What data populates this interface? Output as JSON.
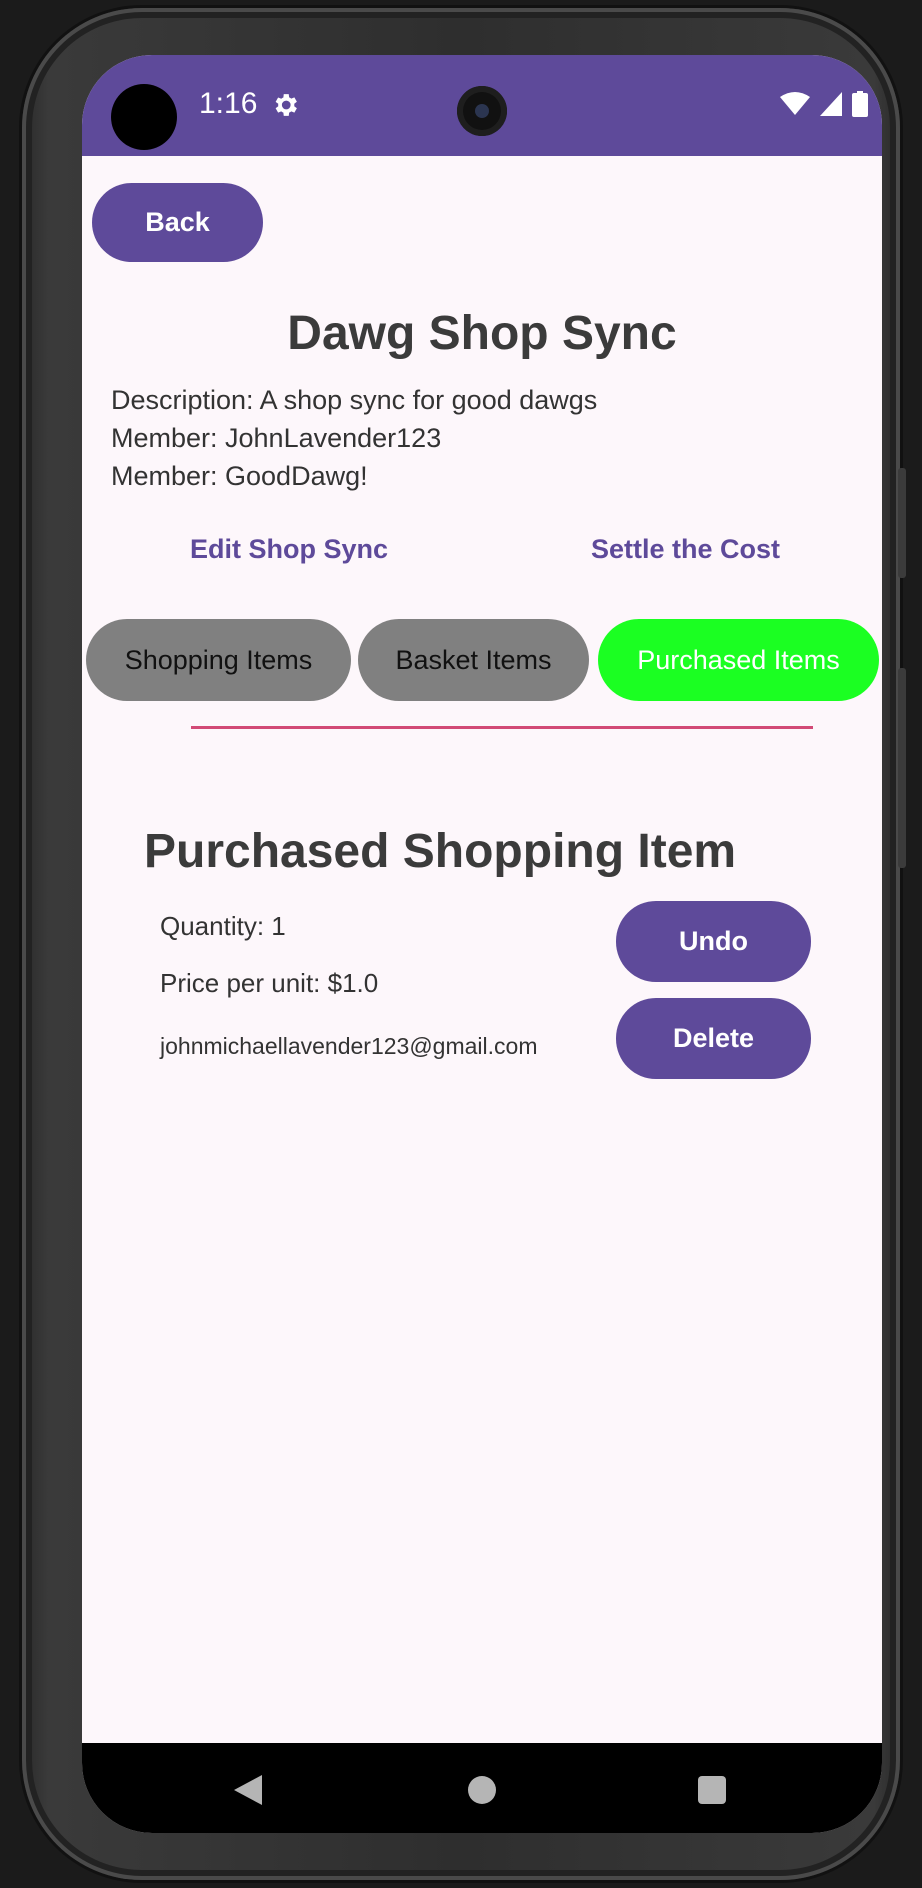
{
  "status_bar": {
    "time": "1:16",
    "icons": [
      "settings-gear-icon",
      "wifi-icon",
      "cellular-signal-icon",
      "battery-icon"
    ]
  },
  "header": {
    "back_label": "Back"
  },
  "shop_sync": {
    "title": "Dawg Shop Sync",
    "description": "Description: A shop sync for good dawgs",
    "members": [
      "Member: JohnLavender123",
      "Member: GoodDawg!"
    ]
  },
  "actions": {
    "edit_label": "Edit Shop Sync",
    "settle_label": "Settle the Cost"
  },
  "tabs": [
    {
      "label": "Shopping Items",
      "active": false
    },
    {
      "label": "Basket Items",
      "active": false
    },
    {
      "label": "Purchased Items",
      "active": true
    }
  ],
  "purchased_item": {
    "name": "Purchased Shopping Item",
    "quantity": "Quantity: 1",
    "price": "Price per unit: $1.0",
    "purchaser": "johnmichaellavender123@gmail.com",
    "undo_label": "Undo",
    "delete_label": "Delete"
  },
  "navigation_bar": {
    "buttons": [
      "back-icon",
      "home-icon",
      "recents-icon"
    ]
  },
  "colors": {
    "primary": "#5e4a9a",
    "active_tab": "#1bff22",
    "inactive_tab": "#808080",
    "divider": "#d24a76",
    "background": "#fdf7fb"
  }
}
